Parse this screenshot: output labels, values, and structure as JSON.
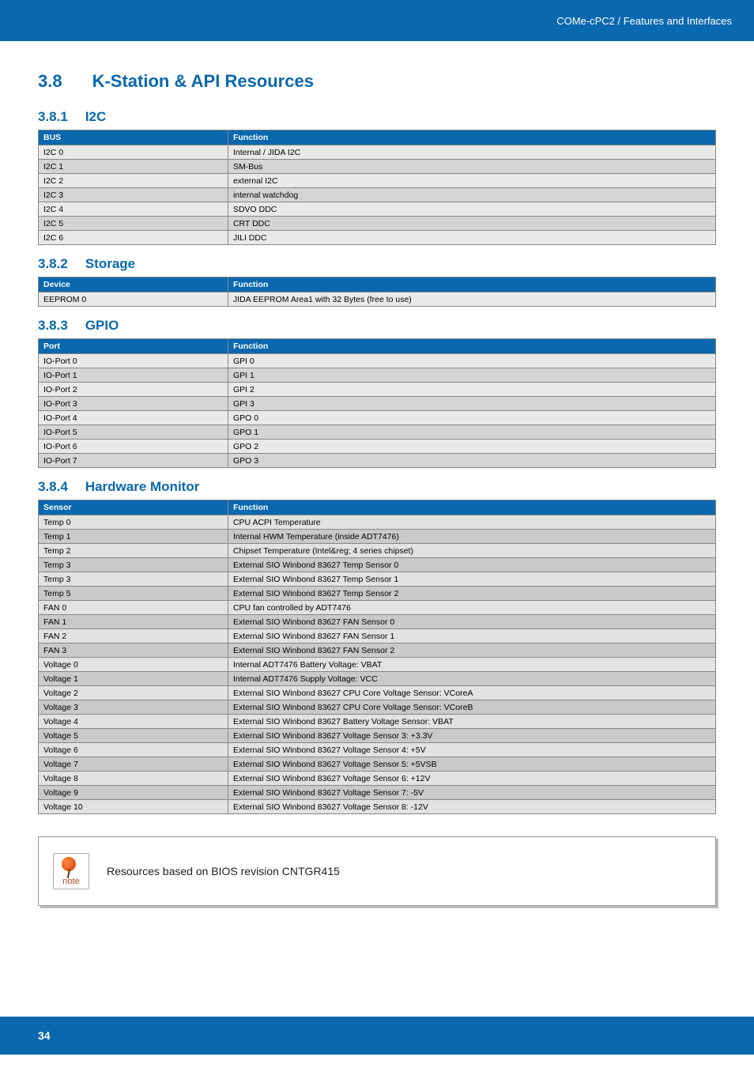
{
  "header": {
    "breadcrumb": "COMe-cPC2 / Features and Interfaces"
  },
  "section": {
    "number": "3.8",
    "title": "K-Station & API Resources"
  },
  "i2c": {
    "number": "3.8.1",
    "title": "I2C",
    "headers": [
      "BUS",
      "Function"
    ],
    "rows": [
      [
        "I2C 0",
        "Internal / JIDA I2C"
      ],
      [
        "I2C 1",
        "SM-Bus"
      ],
      [
        "I2C 2",
        "external I2C"
      ],
      [
        "I2C 3",
        "internal watchdog"
      ],
      [
        "I2C 4",
        "SDVO DDC"
      ],
      [
        "I2C 5",
        "CRT DDC"
      ],
      [
        "I2C 6",
        "JILI DDC"
      ]
    ]
  },
  "storage": {
    "number": "3.8.2",
    "title": "Storage",
    "headers": [
      "Device",
      "Function"
    ],
    "rows": [
      [
        "EEPROM 0",
        "JIDA EEPROM Area1 with 32 Bytes (free to use)"
      ]
    ]
  },
  "gpio": {
    "number": "3.8.3",
    "title": "GPIO",
    "headers": [
      "Port",
      "Function"
    ],
    "rows": [
      [
        "IO-Port 0",
        "GPI 0"
      ],
      [
        "IO-Port 1",
        "GPI 1"
      ],
      [
        "IO-Port 2",
        "GPI 2"
      ],
      [
        "IO-Port 3",
        "GPI 3"
      ],
      [
        "IO-Port 4",
        "GPO 0"
      ],
      [
        "IO-Port 5",
        "GPO 1"
      ],
      [
        "IO-Port 6",
        "GPO 2"
      ],
      [
        "IO-Port 7",
        "GPO 3"
      ]
    ]
  },
  "hw": {
    "number": "3.8.4",
    "title": "Hardware Monitor",
    "headers": [
      "Sensor",
      "Function"
    ],
    "rows": [
      [
        "Temp 0",
        "CPU ACPI Temperature"
      ],
      [
        "Temp 1",
        "Internal HWM Temperature (inside ADT7476)"
      ],
      [
        "Temp 2",
        "Chipset Temperature (Intel&reg; 4 series chipset)"
      ],
      [
        "Temp 3",
        "External SIO Winbond 83627 Temp Sensor 0"
      ],
      [
        "Temp 3",
        "External SIO Winbond 83627 Temp Sensor 1"
      ],
      [
        "Temp 5",
        "External SIO Winbond 83627 Temp Sensor 2"
      ],
      [
        "FAN 0",
        "CPU fan controlled by ADT7476"
      ],
      [
        "FAN 1",
        "External SIO Winbond 83627 FAN Sensor 0"
      ],
      [
        "FAN 2",
        "External SIO Winbond 83627 FAN Sensor 1"
      ],
      [
        "FAN 3",
        "External SIO Winbond 83627 FAN Sensor 2"
      ],
      [
        "Voltage 0",
        "Internal ADT7476 Battery Voltage: VBAT"
      ],
      [
        "Voltage 1",
        "Internal ADT7476 Supply Voltage: VCC"
      ],
      [
        "Voltage 2",
        "External SIO Winbond 83627 CPU Core Voltage Sensor: VCoreA"
      ],
      [
        "Voltage 3",
        "External SIO Winbond 83627 CPU Core Voltage Sensor: VCoreB"
      ],
      [
        "Voltage 4",
        "External SIO Winbond 83627 Battery Voltage Sensor: VBAT"
      ],
      [
        "Voltage 5",
        "External SIO Winbond 83627 Voltage Sensor 3: +3.3V"
      ],
      [
        "Voltage 6",
        "External SIO Winbond 83627 Voltage Sensor 4: +5V"
      ],
      [
        "Voltage 7",
        "External SIO Winbond 83627 Voltage Sensor 5: +5VSB"
      ],
      [
        "Voltage 8",
        "External SIO Winbond 83627 Voltage Sensor 6: +12V"
      ],
      [
        "Voltage 9",
        "External SIO Winbond 83627 Voltage Sensor 7: -5V"
      ],
      [
        "Voltage 10",
        "External SIO Winbond 83627 Voltage Sensor 8: -12V"
      ]
    ]
  },
  "note": {
    "icon_label": "note",
    "text": "Resources based on BIOS revision CNTGR415"
  },
  "footer": {
    "page": "34"
  }
}
